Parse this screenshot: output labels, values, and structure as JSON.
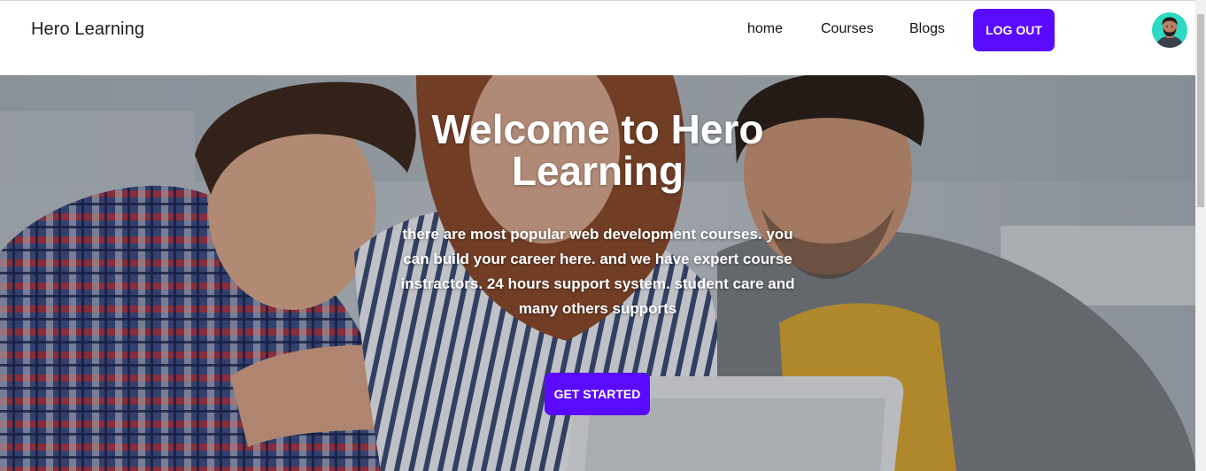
{
  "navbar": {
    "brand": "Hero Learning",
    "links": [
      {
        "label": "home"
      },
      {
        "label": "Courses"
      },
      {
        "label": "Blogs"
      }
    ],
    "logout_label": "LOG OUT",
    "avatar_icon": "user-avatar-icon"
  },
  "hero": {
    "title": "Welcome to Hero Learning",
    "description": "there are most popular web development courses. you can build your career here. and we have expert course instractors. 24 hours support system. student care and many others supports",
    "cta_label": "GET STARTED"
  },
  "colors": {
    "accent": "#5a0bff",
    "navbar_bg": "#ffffff",
    "text_dark": "#111111",
    "hero_text": "#ffffff",
    "avatar_bg": "#30d6c2"
  }
}
